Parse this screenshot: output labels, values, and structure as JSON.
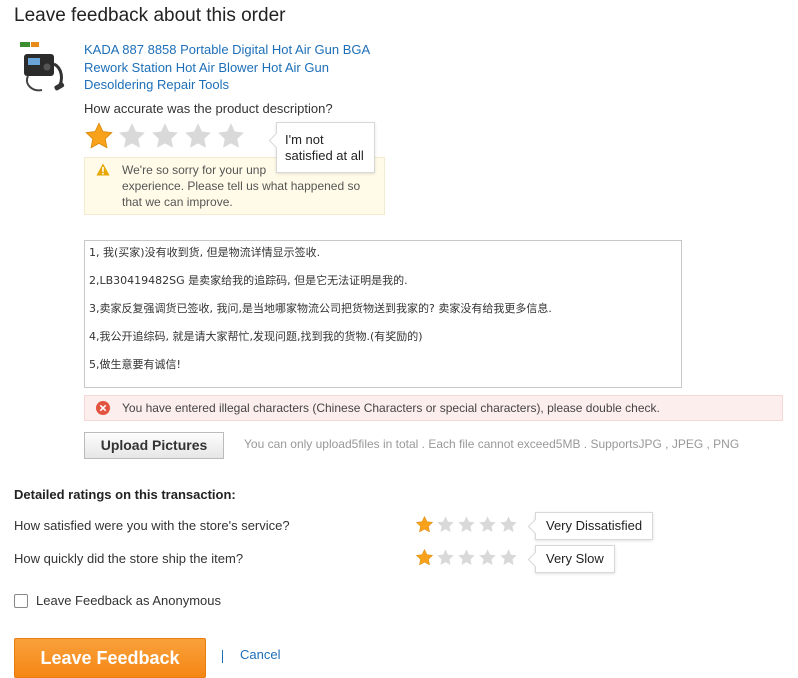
{
  "page": {
    "title": "Leave feedback about this order"
  },
  "product": {
    "title": "KADA 887 8858 Portable Digital Hot Air Gun BGA Rework Station Hot Air Blower Hot Air Gun Desoldering Repair Tools",
    "title_lines": [
      "KADA 887 8858 Portable Digital Hot Air Gun BGA",
      "Rework Station Hot Air Blower Hot Air Gun",
      "Desoldering Repair Tools"
    ]
  },
  "accuracy": {
    "question": "How accurate was the product description?",
    "rating": 1,
    "max": 5,
    "tooltip_lines": [
      "I'm not",
      "satisfied at all"
    ],
    "warning_lines": [
      "We're so sorry for your unp",
      "experience. Please tell us what happened so",
      "that we can improve."
    ]
  },
  "comment": {
    "lines": [
      "1, 我(买家)没有收到货, 但是物流详情显示签收.",
      "2,LB30419482SG 是卖家给我的追踪码, 但是它无法证明是我的.",
      "3,卖家反复强调货已签收, 我问,是当地哪家物流公司把货物送到我家的? 卖家没有给我更多信息.",
      "4,我公开追综码, 就是请大家帮忙,发现问题,找到我的货物.(有奖励的)",
      "5,做生意要有诚信!"
    ]
  },
  "error": {
    "text": "You have entered illegal characters (Chinese Characters or special characters), please double check."
  },
  "upload": {
    "button_label": "Upload Pictures",
    "hint": "You can only upload5files in total . Each file cannot exceed5MB . SupportsJPG , JPEG , PNG"
  },
  "detailed": {
    "title": "Detailed ratings on this transaction:",
    "items": [
      {
        "label": "How satisfied were you with the store's service?",
        "rating": 1,
        "max": 5,
        "tooltip": "Very Dissatisfied"
      },
      {
        "label": "How quickly did the store ship the item?",
        "rating": 1,
        "max": 5,
        "tooltip": "Very Slow"
      }
    ]
  },
  "anonymous": {
    "label": "Leave Feedback as Anonymous",
    "checked": false
  },
  "actions": {
    "submit_label": "Leave Feedback",
    "separator": "|",
    "cancel_label": "Cancel"
  },
  "colors": {
    "star_filled": "#f7a21a",
    "star_empty": "#d9d9d9",
    "link": "#1d6fb8",
    "primary": "#f58614",
    "error_icon": "#e2543f",
    "warning_icon": "#e7a600"
  }
}
